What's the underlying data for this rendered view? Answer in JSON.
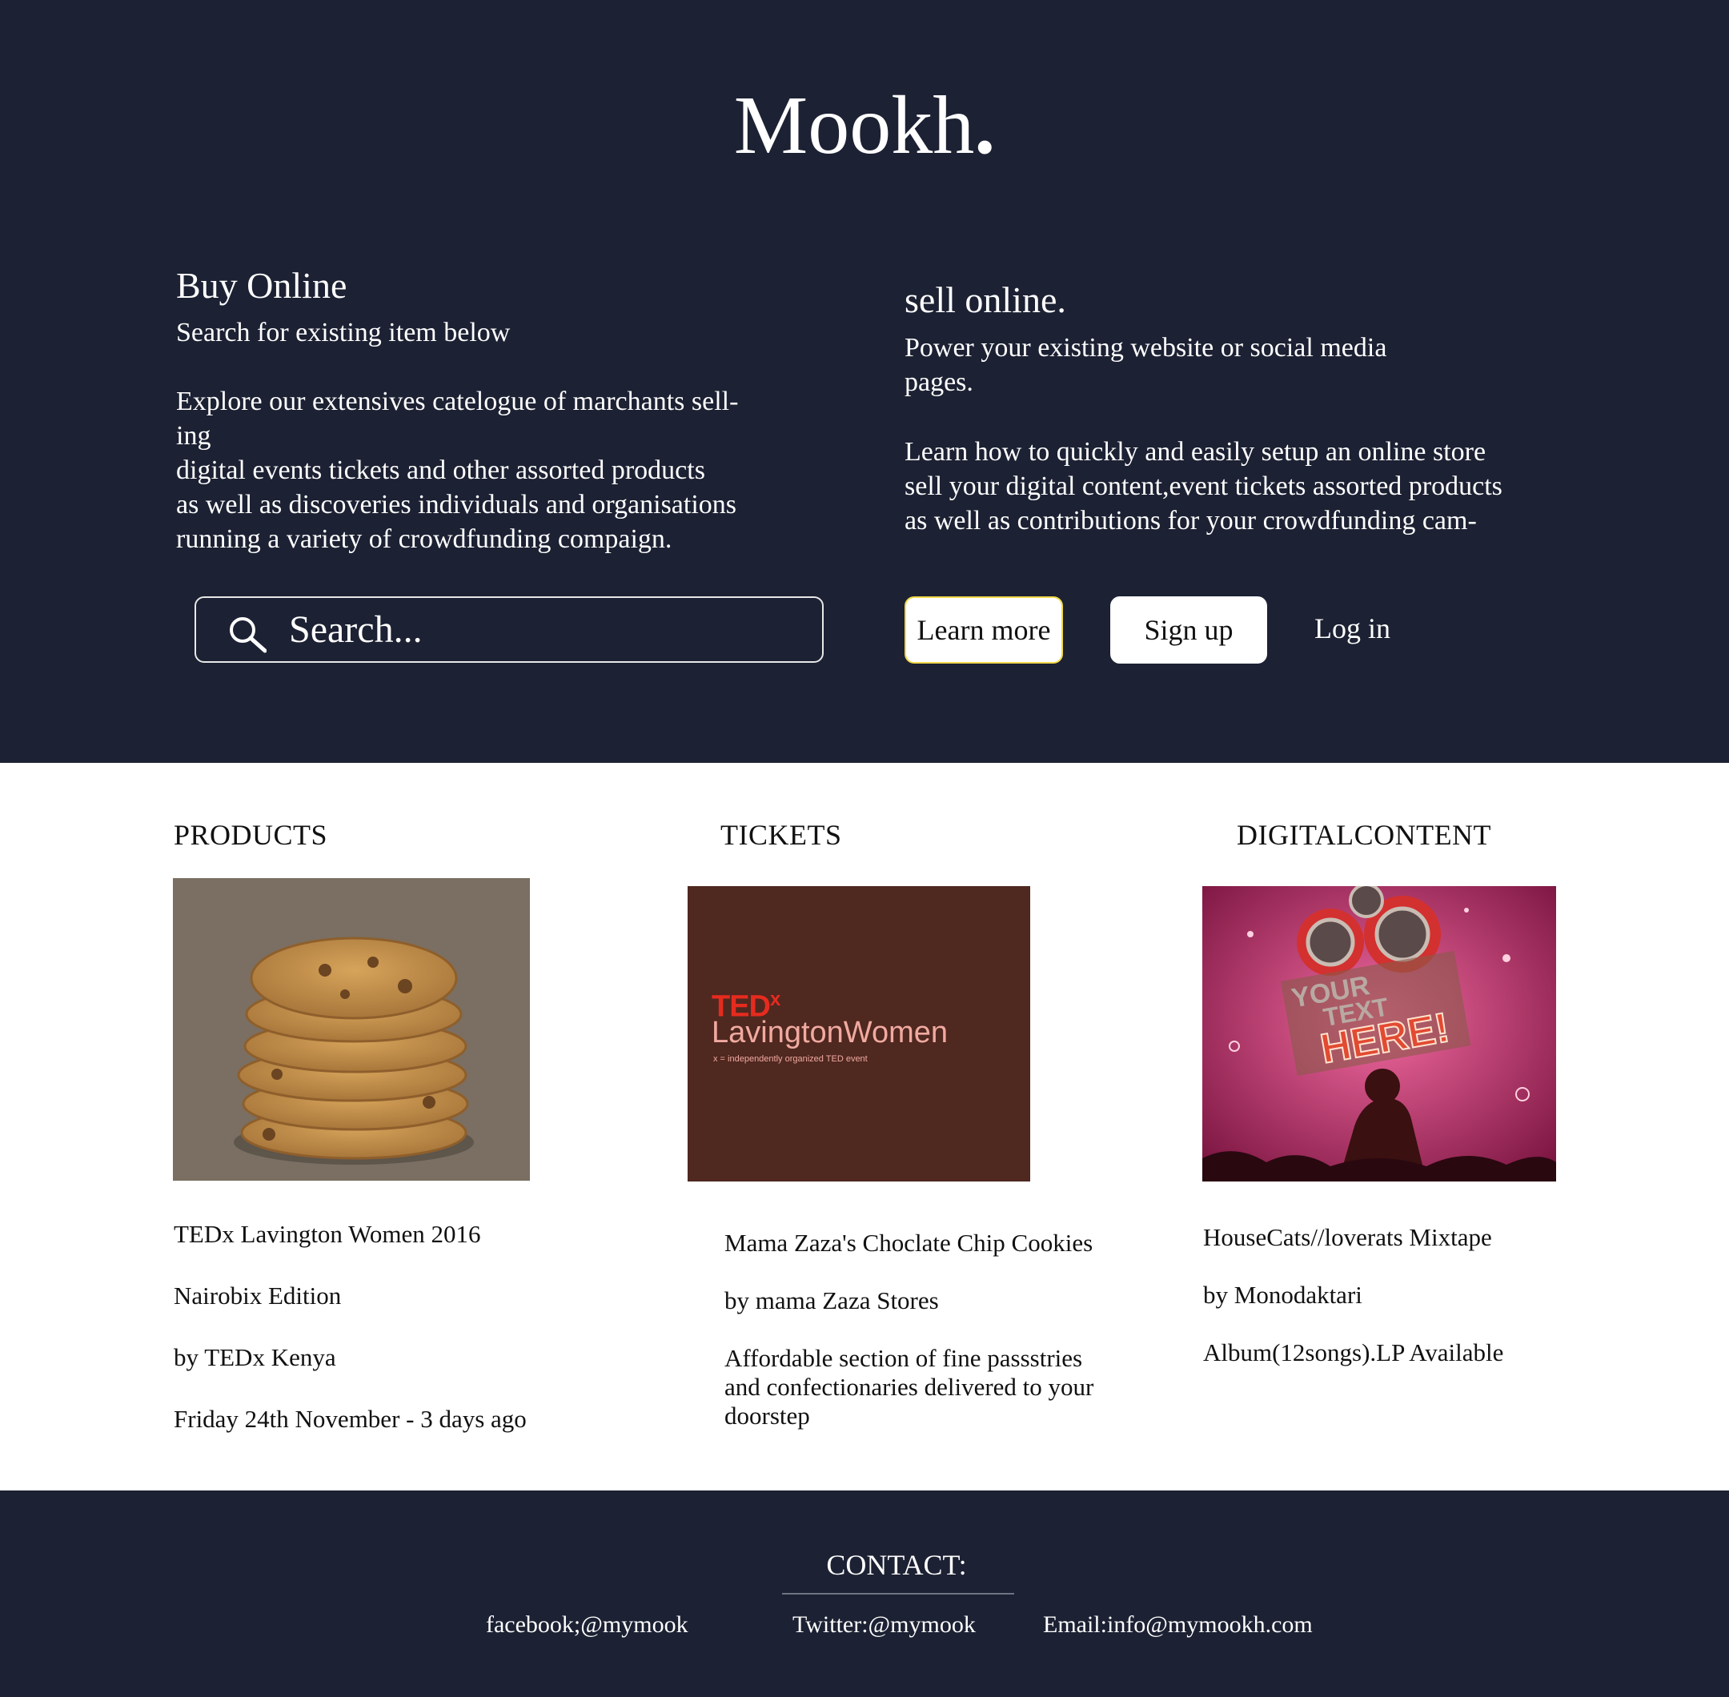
{
  "brand": {
    "name": "Mookh",
    "dot": "."
  },
  "buy": {
    "title": "Buy Online",
    "subtitle": "Search for existing  item below",
    "body": [
      "Explore our extensives catelogue of marchants sell-",
      "ing",
      "digital events tickets and other assorted products",
      "as well as discoveries individuals and organisations",
      "running a variety of crowdfunding compaign."
    ],
    "search_placeholder": "Search..."
  },
  "sell": {
    "title": "sell online.",
    "intro": [
      "Power your existing website or social media",
      "pages."
    ],
    "body": [
      "Learn how to quickly and easily setup an online store",
      "sell your digital content,event tickets assorted products",
      "as well as contributions for your crowdfunding cam-"
    ],
    "learn_more": "Learn more",
    "sign_up": "Sign up",
    "log_in": "Log in"
  },
  "categories": {
    "products": "PRODUCTS",
    "tickets": "TICKETS",
    "digital": "DIGITALCONTENT"
  },
  "products": [
    "TEDx Lavington Women 2016",
    "Nairobix Edition",
    "by TEDx Kenya",
    "Friday 24th November - 3 days ago"
  ],
  "tickets": {
    "lines": [
      "Mama Zaza's Choclate Chip Cookies",
      "by mama Zaza Stores"
    ],
    "desc": [
      "Affordable section of fine passstries",
      "and confectionaries delivered to your",
      "doorstep"
    ]
  },
  "digital": [
    "HouseCats//loverats Mixtape",
    "by Monodaktari",
    "Album(12songs).LP Available"
  ],
  "ticket_image": {
    "ted": "TED",
    "x": "x",
    "event": "LavingtonWomen",
    "tag": "x = independently organized TED event"
  },
  "poster_image": {
    "line1": "YOUR",
    "line2": "TEXT",
    "line3": "HERE!"
  },
  "footer": {
    "contact": "CONTACT:",
    "facebook": "facebook;@mymook",
    "twitter": "Twitter:@mymook",
    "email": "Email:info@mymookh.com"
  },
  "colors": {
    "navy": "#1c2133",
    "ted_red": "#e62b1e",
    "ticket_bg": "#4f2820",
    "poster_pink": "#c8285e"
  }
}
